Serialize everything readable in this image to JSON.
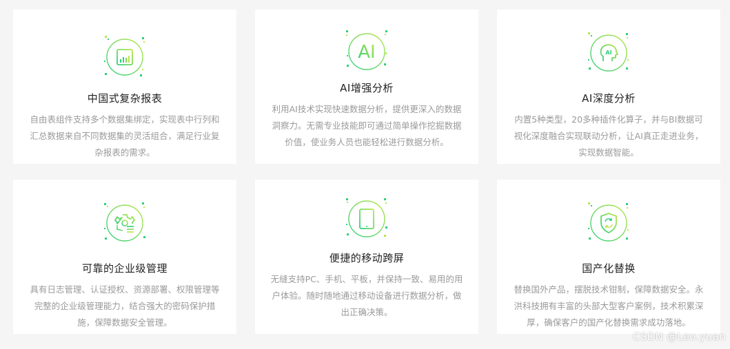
{
  "colors": {
    "accent_start": "#2fcf7a",
    "accent_end": "#b9e64a",
    "title": "#222222",
    "desc": "#9a9a9a"
  },
  "cards": [
    {
      "icon": "report-chart-icon",
      "title": "中国式复杂报表",
      "desc": "自由表组件支持多个数据集绑定，实现表中行列和汇总数据来自不同数据集的灵活组合，满足行业复杂报表的需求。"
    },
    {
      "icon": "ai-text-icon",
      "icon_text": "AI",
      "title": "AI增强分析",
      "desc": "利用AI技术实现快速数据分析，提供更深入的数据洞察力。无需专业技能即可通过简单操作挖掘数据价值，使业务人员也能轻松进行数据分析。"
    },
    {
      "icon": "ai-head-icon",
      "icon_text": "AI",
      "title": "AI深度分析",
      "desc": "内置5种类型，20多种插件化算子，并与BI数据可视化深度融合实现联动分析，让AI真正走进业务，实现数据智能。"
    },
    {
      "icon": "gear-settings-icon",
      "title": "可靠的企业级管理",
      "desc": "具有日志管理、认证授权、资源部署、权限管理等完整的企业级管理能力，结合强大的密码保护措施，保障数据安全管理。"
    },
    {
      "icon": "tablet-icon",
      "title": "便捷的移动跨屏",
      "desc": "无缝支持PC、手机、平板，并保持一致、易用的用户体验。随时随地通过移动设备进行数据分析，做出正确决策。"
    },
    {
      "icon": "shield-refresh-icon",
      "title": "国产化替换",
      "desc": "替换国外产品，摆脱技术钳制，保障数据安全。永洪科技拥有丰富的头部大型客户案例，技术积累深厚，确保客户的国产化替换需求成功落地。"
    }
  ],
  "watermark": "CSDN @Leo.yuan"
}
